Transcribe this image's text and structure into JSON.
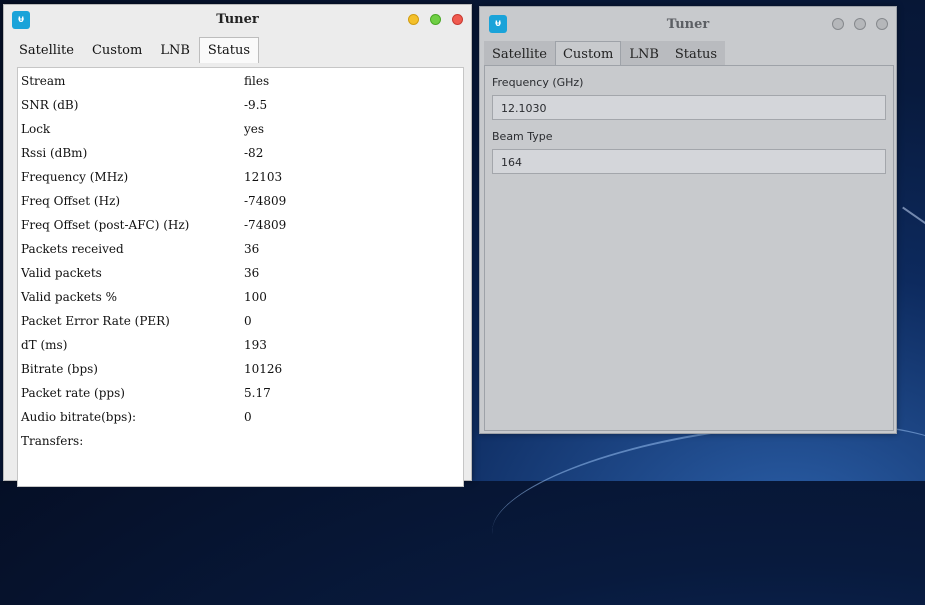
{
  "left_window": {
    "title": "Tuner",
    "tabs": [
      "Satellite",
      "Custom",
      "LNB",
      "Status"
    ],
    "active_tab": "Status",
    "status_rows": [
      {
        "label": "Stream",
        "value": "files"
      },
      {
        "label": "SNR (dB)",
        "value": "-9.5"
      },
      {
        "label": "Lock",
        "value": "yes"
      },
      {
        "label": "Rssi (dBm)",
        "value": "-82"
      },
      {
        "label": "Frequency (MHz)",
        "value": "12103"
      },
      {
        "label": "Freq Offset (Hz)",
        "value": "-74809"
      },
      {
        "label": "Freq Offset (post-AFC) (Hz)",
        "value": "-74809"
      },
      {
        "label": "Packets received",
        "value": "36"
      },
      {
        "label": "Valid packets",
        "value": "36"
      },
      {
        "label": "Valid packets %",
        "value": "100"
      },
      {
        "label": "Packet Error Rate (PER)",
        "value": "0"
      },
      {
        "label": "dT (ms)",
        "value": "193"
      },
      {
        "label": "Bitrate (bps)",
        "value": "10126"
      },
      {
        "label": "Packet rate (pps)",
        "value": "5.17"
      },
      {
        "label": "Audio bitrate(bps):",
        "value": "0"
      },
      {
        "label": "Transfers:",
        "value": ""
      }
    ]
  },
  "right_window": {
    "title": "Tuner",
    "tabs": [
      "Satellite",
      "Custom",
      "LNB",
      "Status"
    ],
    "active_tab": "Custom",
    "frequency_label": "Frequency (GHz)",
    "frequency_value": "12.1030",
    "beam_type_label": "Beam Type",
    "beam_type_value": "164"
  },
  "icons": {
    "app": "radio-wave-icon"
  },
  "colors": {
    "app_icon": "#1aa3d9",
    "minimize": "#f4c02a",
    "maximize": "#6fcf44",
    "close": "#f05a4f"
  }
}
